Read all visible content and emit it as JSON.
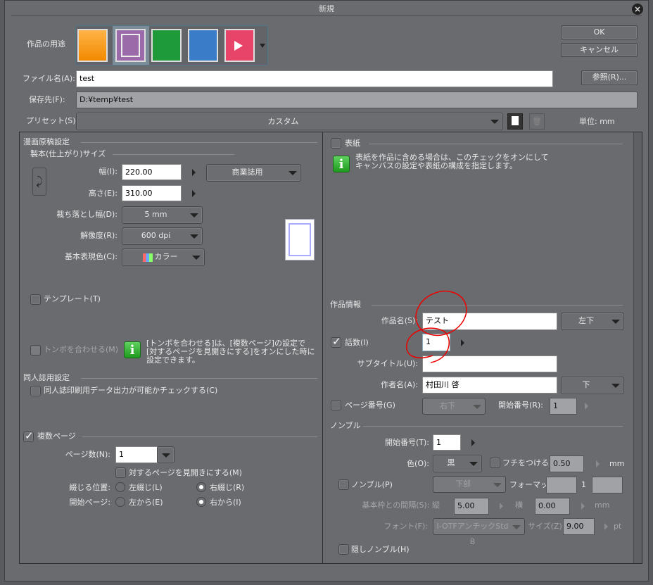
{
  "title": "新規",
  "usage": {
    "label": "作品の用途",
    "icons": [
      "illustration-icon",
      "comic-icon",
      "book-icon",
      "print-icon",
      "animation-icon"
    ],
    "selected": 1
  },
  "buttons": {
    "ok": "OK",
    "cancel": "キャンセル",
    "browse": "参照(R)..."
  },
  "file_name": {
    "label": "ファイル名(A):",
    "value": "test"
  },
  "save_to": {
    "label": "保存先(F):",
    "value": "D:¥temp¥test"
  },
  "preset": {
    "label": "プリセット(S):",
    "value": "カスタム",
    "unit": "単位: mm"
  },
  "manga": {
    "heading": "漫画原稿設定",
    "size_heading": "製本(仕上がり)サイズ",
    "width": {
      "label": "幅(I):",
      "value": "220.00"
    },
    "height": {
      "label": "高さ(E):",
      "value": "310.00"
    },
    "size_preset": "商業誌用",
    "bleed": {
      "label": "裁ち落とし幅(D):",
      "value": "5 mm"
    },
    "resolution": {
      "label": "解像度(R):",
      "value": "600 dpi"
    },
    "color": {
      "label": "基本表現色(C):",
      "value": "カラー"
    },
    "template": "テンプレート(T)",
    "align_marks": "トンボを合わせる(M)",
    "info": [
      "[トンボを合わせる]は、[複数ページ]の設定で",
      "[対するページを見開きにする]をオンにした時に",
      "設定できます。"
    ]
  },
  "doujin": {
    "heading": "同人誌用設定",
    "check": "同人誌印刷用データ出力が可能かチェックする(C)"
  },
  "multi": {
    "heading": "複数ページ",
    "pages": {
      "label": "ページ数(N):",
      "value": "1"
    },
    "spread": "対するページを見開きにする(M)",
    "binding": {
      "label": "綴じる位置:",
      "left": "左綴じ(L)",
      "right": "右綴じ(R)"
    },
    "start": {
      "label": "開始ページ:",
      "left": "左から(E)",
      "right": "右から(I)"
    }
  },
  "cover": {
    "heading": "表紙",
    "info": [
      "表紙を作品に含める場合は、このチェックをオンにして",
      "キャンバスの設定や表紙の構成を指定します。"
    ]
  },
  "work": {
    "heading": "作品情報",
    "title": {
      "label": "作品名(S):",
      "value": "テスト",
      "pos": "左下"
    },
    "episode": {
      "label": "話数(I)",
      "value": "1"
    },
    "subtitle": {
      "label": "サブタイトル(U):",
      "value": ""
    },
    "author": {
      "label": "作者名(A):",
      "value": "村田川 啓",
      "pos": "下"
    },
    "page_no": {
      "label": "ページ番号(G)",
      "pos": "右下",
      "start_label": "開始番号(R):",
      "start": "1"
    }
  },
  "nombre": {
    "heading": "ノンブル",
    "start": {
      "label": "開始番号(T):",
      "value": "1"
    },
    "color": {
      "label": "色(O):",
      "value": "黒"
    },
    "border": {
      "label": "フチをつける(E)",
      "value": "0.50",
      "unit": "mm"
    },
    "check": "ノンブル(P)",
    "pos": "下部",
    "format_label": "フォーマット:",
    "format_mid": "1",
    "gap": {
      "label": "基本枠との間隔(S): 縦",
      "v": "5.00",
      "h_label": "横",
      "h": "0.00",
      "unit": "mm"
    },
    "font": {
      "label": "フォント(F):",
      "value": "I-OTFアンチックStd B",
      "size_label": "サイズ(Z):",
      "size": "9.00",
      "unit": "pt"
    },
    "hidden": "隠しノンブル(H)"
  }
}
